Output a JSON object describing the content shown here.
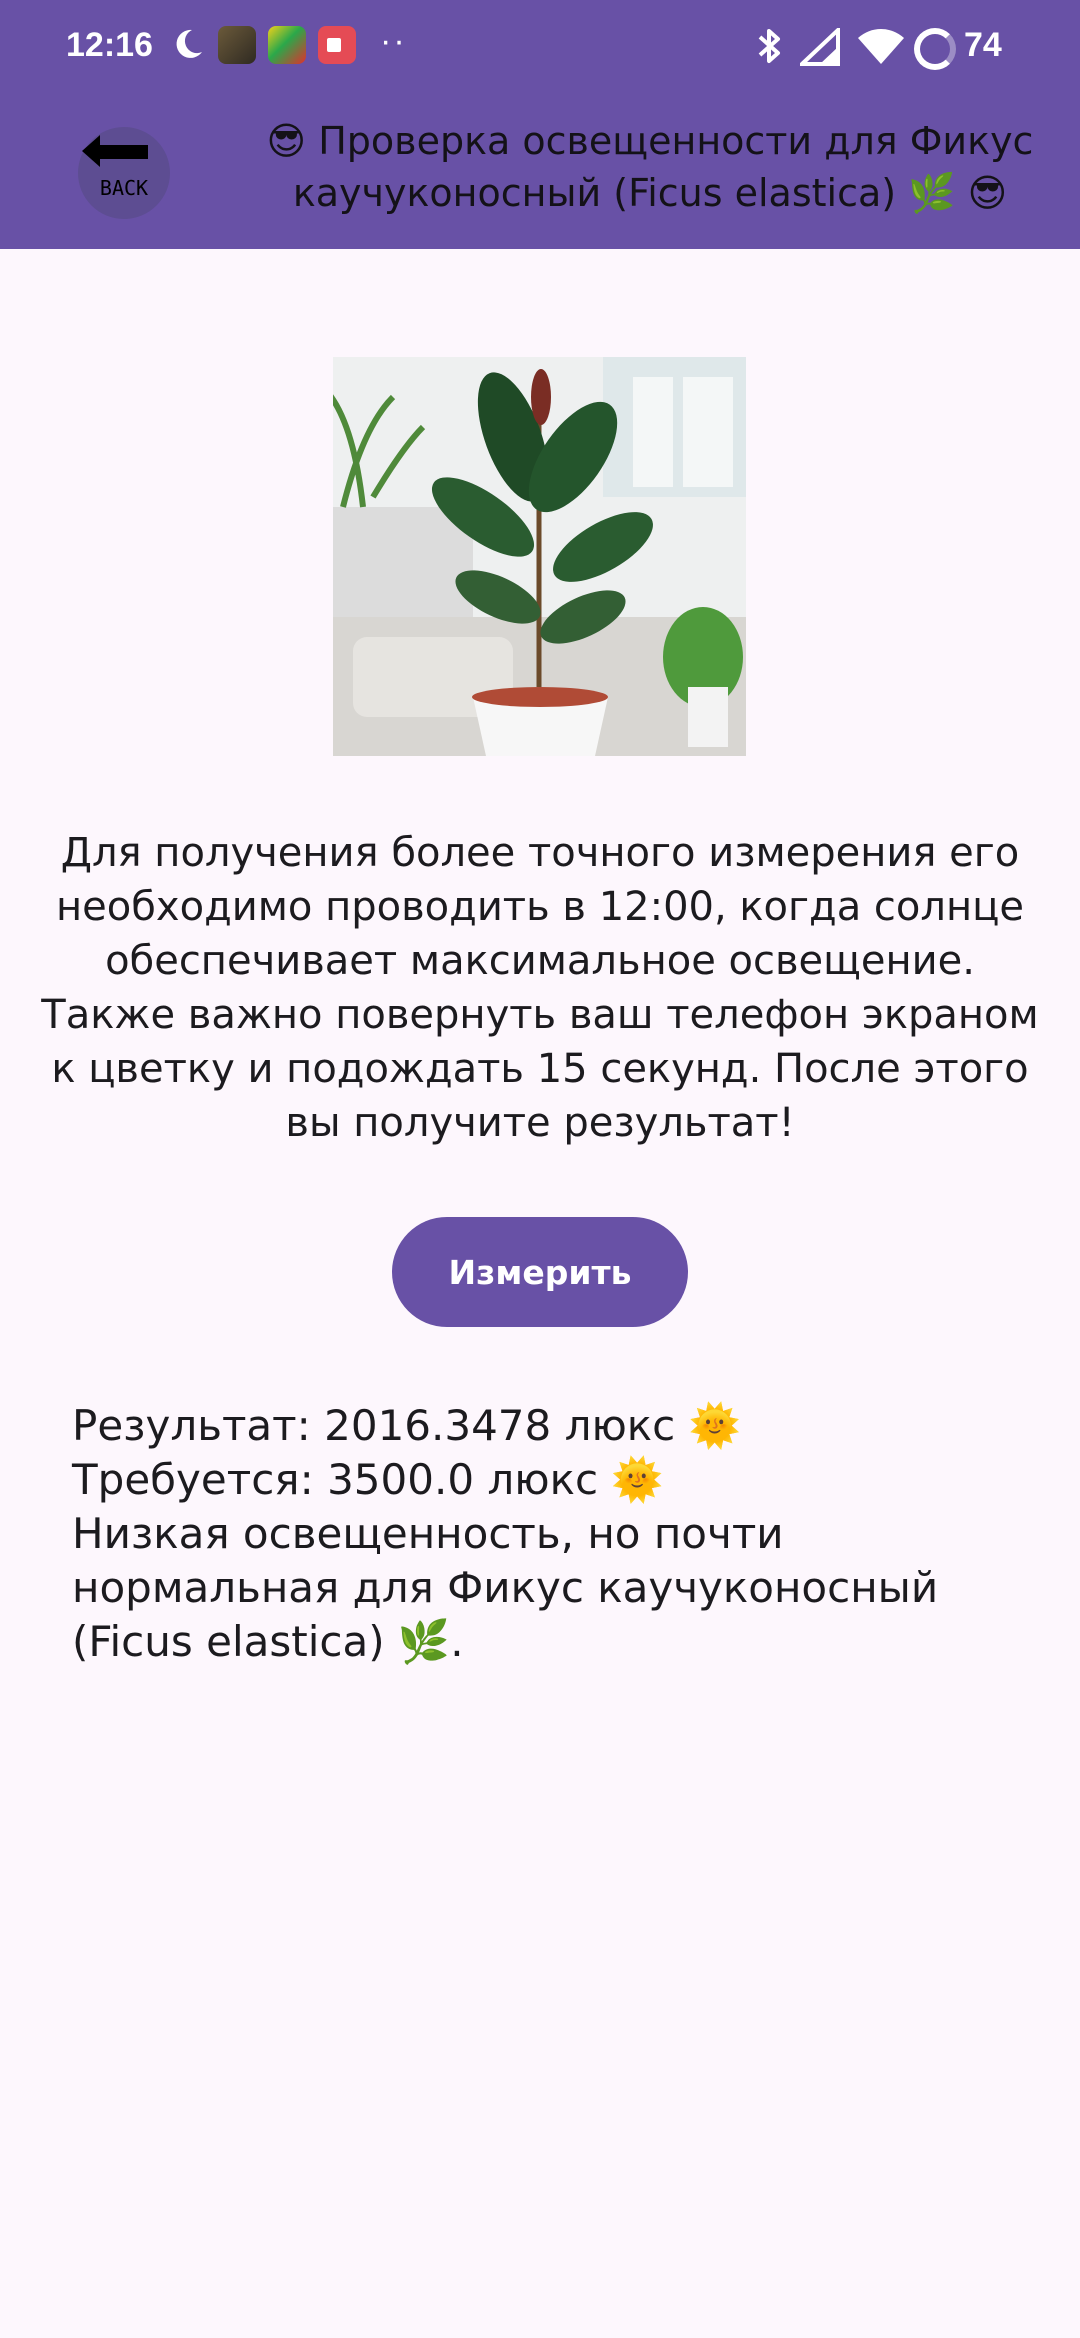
{
  "status_bar": {
    "time": "12:16",
    "battery": "74",
    "overflow": "··",
    "icons": [
      "moon-icon",
      "notification-app-1",
      "notification-app-2",
      "notification-app-3",
      "bluetooth-icon",
      "signal-icon",
      "wifi-icon",
      "battery-ring-icon"
    ]
  },
  "header": {
    "back_label": "BACK",
    "title": "😎 Проверка освещенности для Фикус каучуконосный (Ficus elastica) 🌿 😎"
  },
  "plant_image": {
    "subject": "ficus-elastica-photo"
  },
  "instructions": "Для получения более точного измерения его необходимо проводить в 12:00, когда солнце обеспечивает максимальное освещение. Также важно повернуть ваш телефон экраном к цветку и подождать 15 секунд. После этого вы получите результат!",
  "measure_button": {
    "label": "Измерить"
  },
  "result": {
    "line1": "Результат: 2016.3478 люкс 🌞",
    "line2": "Требуется: 3500.0 люкс 🌞",
    "line3": "Низкая освещенность, но почти нормальная для Фикус каучуконосный (Ficus elastica) 🌿."
  },
  "colors": {
    "app_bar": "#6851a6",
    "background": "#fdf7fd",
    "button": "#6851a6"
  }
}
